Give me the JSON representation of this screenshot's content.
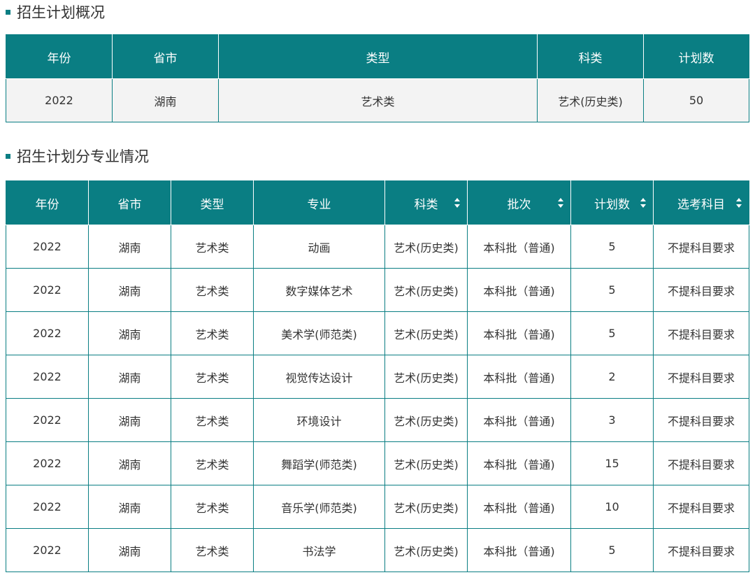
{
  "overview": {
    "title": "招生计划概况",
    "headers": [
      "年份",
      "省市",
      "类型",
      "科类",
      "计划数"
    ],
    "row": [
      "2022",
      "湖南",
      "艺术类",
      "艺术(历史类)",
      "50"
    ]
  },
  "detail": {
    "title": "招生计划分专业情况",
    "headers": [
      {
        "label": "年份",
        "sortable": false
      },
      {
        "label": "省市",
        "sortable": false
      },
      {
        "label": "类型",
        "sortable": false
      },
      {
        "label": "专业",
        "sortable": false
      },
      {
        "label": "科类",
        "sortable": true
      },
      {
        "label": "批次",
        "sortable": true
      },
      {
        "label": "计划数",
        "sortable": true
      },
      {
        "label": "选考科目",
        "sortable": true
      }
    ],
    "rows": [
      [
        "2022",
        "湖南",
        "艺术类",
        "动画",
        "艺术(历史类)",
        "本科批（普通)",
        "5",
        "不提科目要求"
      ],
      [
        "2022",
        "湖南",
        "艺术类",
        "数字媒体艺术",
        "艺术(历史类)",
        "本科批（普通)",
        "5",
        "不提科目要求"
      ],
      [
        "2022",
        "湖南",
        "艺术类",
        "美术学(师范类)",
        "艺术(历史类)",
        "本科批（普通)",
        "5",
        "不提科目要求"
      ],
      [
        "2022",
        "湖南",
        "艺术类",
        "视觉传达设计",
        "艺术(历史类)",
        "本科批（普通)",
        "2",
        "不提科目要求"
      ],
      [
        "2022",
        "湖南",
        "艺术类",
        "环境设计",
        "艺术(历史类)",
        "本科批（普通)",
        "3",
        "不提科目要求"
      ],
      [
        "2022",
        "湖南",
        "艺术类",
        "舞蹈学(师范类)",
        "艺术(历史类)",
        "本科批（普通)",
        "15",
        "不提科目要求"
      ],
      [
        "2022",
        "湖南",
        "艺术类",
        "音乐学(师范类)",
        "艺术(历史类)",
        "本科批（普通)",
        "10",
        "不提科目要求"
      ],
      [
        "2022",
        "湖南",
        "艺术类",
        "书法学",
        "艺术(历史类)",
        "本科批（普通)",
        "5",
        "不提科目要求"
      ]
    ]
  },
  "colors": {
    "header_bg": "#0a7e83",
    "header_text": "#ffffff",
    "border": "#0a7e83",
    "overview_row_bg": "#f3f3f3"
  },
  "icons": {
    "section_bullet": "square-bullet-icon",
    "sort": "sort-icon"
  }
}
